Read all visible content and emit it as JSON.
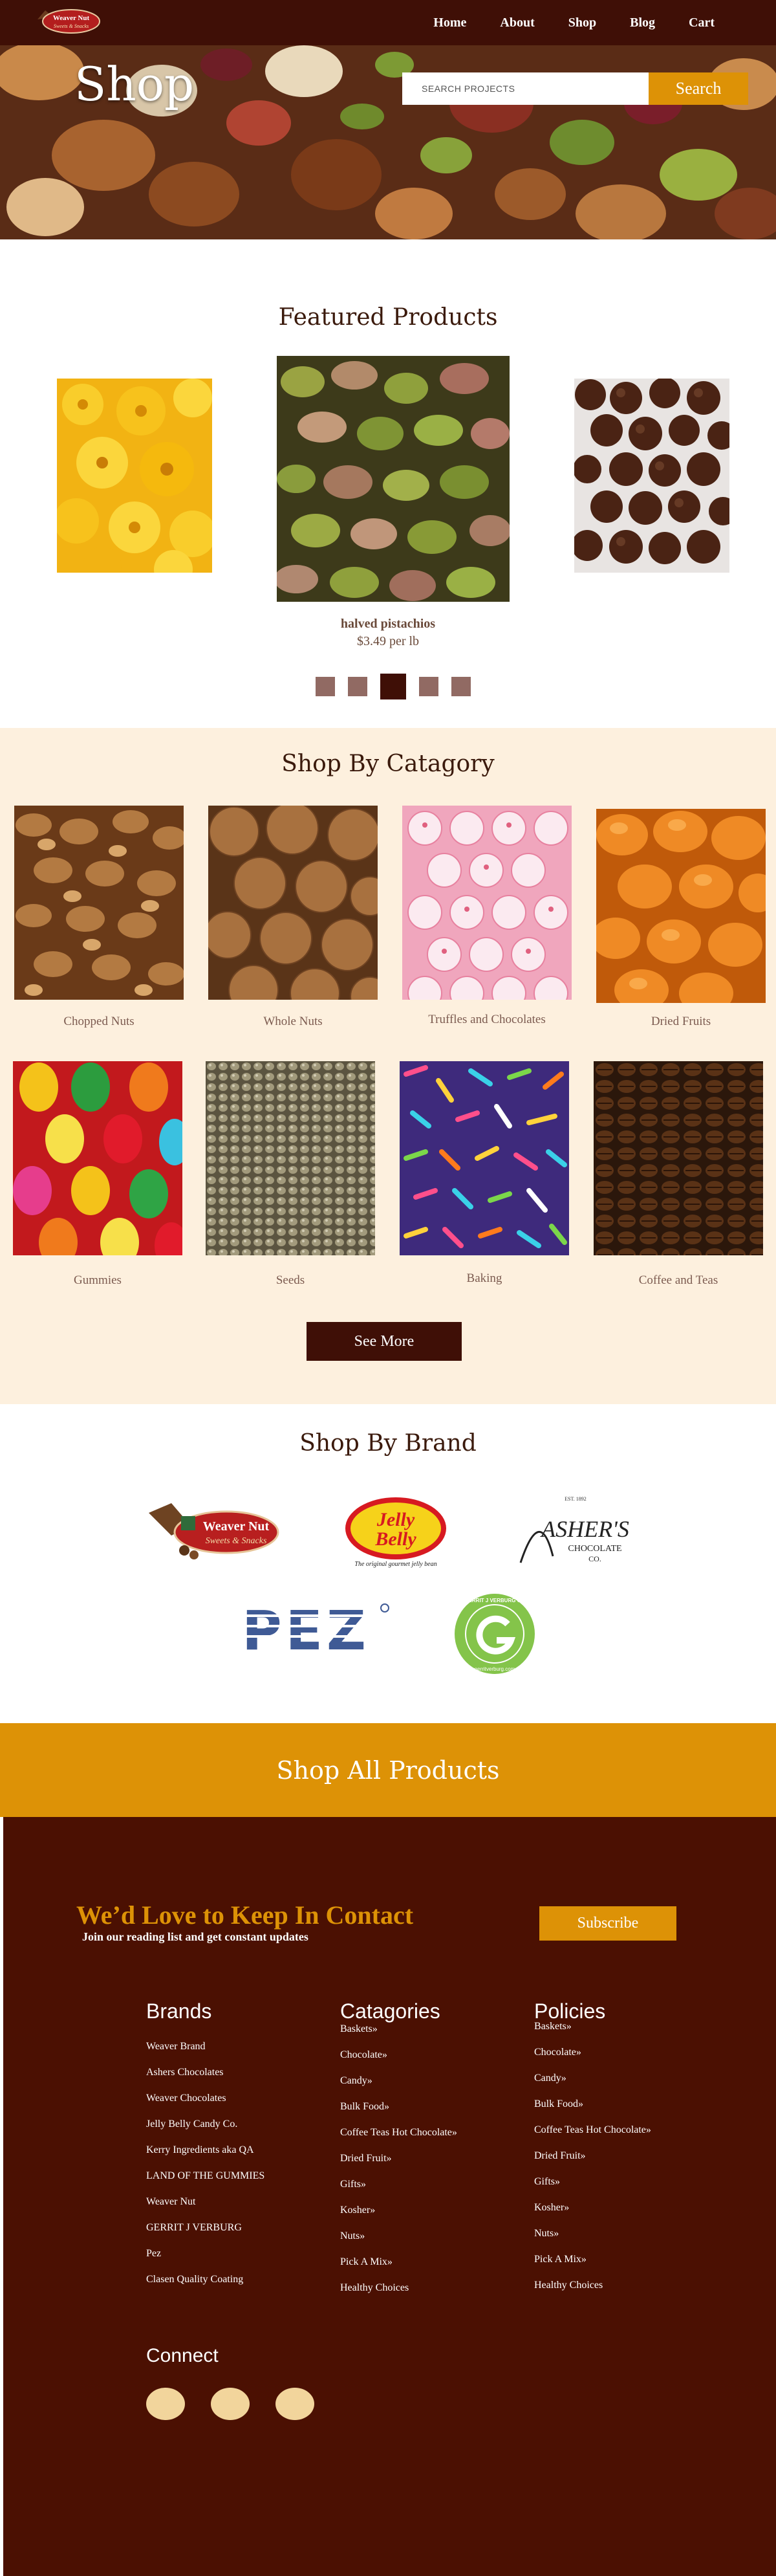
{
  "nav": {
    "links": [
      "Home",
      "About",
      "Shop",
      "Blog",
      "Cart"
    ],
    "logo_text": [
      "Weaver Nut",
      "Sweets & Snacks"
    ]
  },
  "hero": {
    "title": "Shop",
    "search_placeholder": "SEARCH PROJECTS",
    "search_button": "Search"
  },
  "featured": {
    "title": "Featured Products",
    "current": {
      "name": "halved pistachios",
      "price": "$3.49 per lb"
    },
    "dot_count": 5,
    "active_dot": 3
  },
  "categories": {
    "title": "Shop By Catagory",
    "items": [
      "Chopped Nuts",
      "Whole Nuts",
      "Truffles and Chocolates",
      "Dried Fruits",
      "Gummies",
      "Seeds",
      "Baking",
      "Coffee and Teas"
    ],
    "see_more": "See More"
  },
  "brands": {
    "title": "Shop By Brand",
    "logos": {
      "weaver": [
        "Weaver Nut",
        "Sweets & Snacks"
      ],
      "jelly_belly": [
        "Jelly",
        "Belly",
        "The original gourmet jelly bean"
      ],
      "ashers": [
        "ASHER'S",
        "CHOCOLATE",
        "CO.",
        "EST. 1892"
      ],
      "pez": "PEZ",
      "verburg": [
        "GERRIT J VERBURG CO",
        "gerritverburg.com"
      ]
    }
  },
  "all_products": "Shop All Products",
  "footer": {
    "heading": "We’d Love to Keep In Contact",
    "subheading": "Join our reading list and get constant updates",
    "subscribe": "Subscribe",
    "brands_title": "Brands",
    "brands": [
      "Weaver Brand",
      "Ashers Chocolates",
      "Weaver Chocolates",
      "Jelly Belly Candy Co.",
      "Kerry Ingredients aka QA",
      "LAND OF THE GUMMIES",
      "Weaver Nut",
      "GERRIT J VERBURG",
      "Pez",
      "Clasen Quality Coating"
    ],
    "categories_title": "Catagories",
    "categories": [
      "Baskets»",
      "Chocolate»",
      "Candy»",
      "Bulk Food»",
      "Coffee Teas Hot Chocolate»",
      "Dried Fruit»",
      "Gifts»",
      "Kosher»",
      "Nuts»",
      "Pick A Mix»",
      "Healthy Choices"
    ],
    "policies_title": "Policies",
    "policies": [
      "Baskets»",
      "Chocolate»",
      "Candy»",
      "Bulk Food»",
      "Coffee Teas Hot Chocolate»",
      "Dried Fruit»",
      "Gifts»",
      "Kosher»",
      "Nuts»",
      "Pick A Mix»",
      "Healthy Choices"
    ],
    "connect": "Connect",
    "social_count": 3
  },
  "colors": {
    "brown": "#3f0f06",
    "footer": "#4b1002",
    "gold": "#dd9206",
    "cream": "#fdf0de",
    "dot": "#916a63"
  }
}
